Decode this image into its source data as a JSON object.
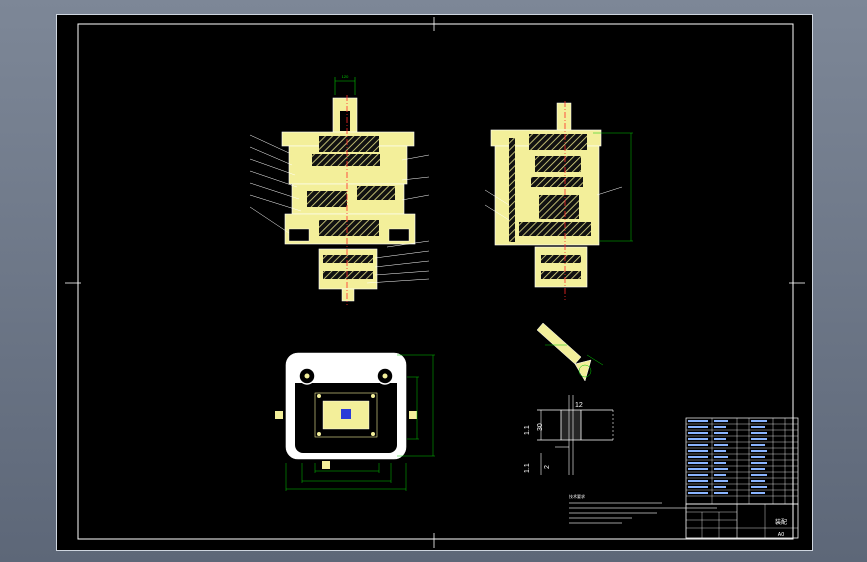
{
  "colors": {
    "background": "#000000",
    "frame": "#ffffff",
    "part_fill": "#f3ef9a",
    "hatch": "#111111",
    "dimension": "#00c800",
    "centerline": "#ff2a2a",
    "leader": "#ffffff",
    "title_block": "#ffffff",
    "title_block_text": "#8ab4ff"
  },
  "views": {
    "front": {
      "name": "front-view",
      "top_dim_label": "120"
    },
    "side": {
      "name": "side-view"
    },
    "plan": {
      "name": "plan-view"
    },
    "detail": {
      "name": "detail-view",
      "labels": [
        "12",
        "30",
        "1.1",
        "1.1",
        "2"
      ]
    },
    "notes": {
      "title": "技术要求"
    }
  },
  "title_block": {
    "drawing_title": "装配",
    "scale": "A0"
  }
}
